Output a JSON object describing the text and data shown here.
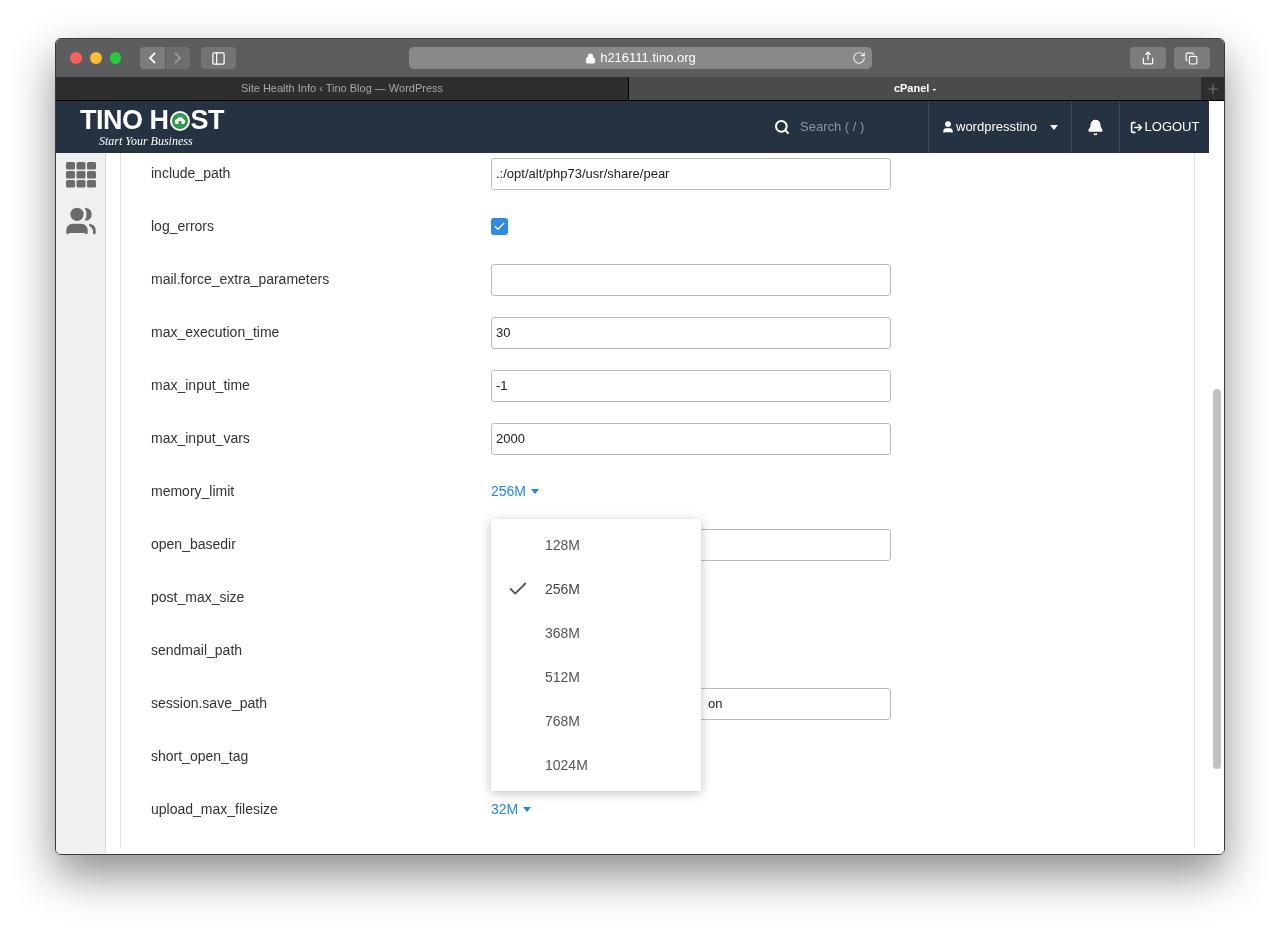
{
  "browser": {
    "url": "h216111.tino.org",
    "tabs": [
      {
        "title": "Site Health Info ‹ Tino Blog — WordPress",
        "selected": false
      },
      {
        "title": "cPanel -",
        "selected": true
      }
    ]
  },
  "header": {
    "logo": {
      "before": "TINO H",
      "after": "ST",
      "tagline": "Start Your Business"
    },
    "search_placeholder": "Search ( / )",
    "user": "wordpresstino",
    "logout": "LOGOUT"
  },
  "settings": [
    {
      "name": "include_path",
      "kind": "text",
      "value": ".:/opt/alt/php73/usr/share/pear"
    },
    {
      "name": "log_errors",
      "kind": "checkbox",
      "checked": true
    },
    {
      "name": "mail.force_extra_parameters",
      "kind": "text"
    },
    {
      "name": "max_execution_time",
      "kind": "text",
      "value": "30"
    },
    {
      "name": "max_input_time",
      "kind": "text",
      "value": "-1"
    },
    {
      "name": "max_input_vars",
      "kind": "text",
      "value": "2000"
    },
    {
      "name": "memory_limit",
      "kind": "dropdown",
      "value": "256M",
      "options": [
        {
          "label": "128M",
          "selected": false
        },
        {
          "label": "256M",
          "selected": true
        },
        {
          "label": "368M",
          "selected": false
        },
        {
          "label": "512M",
          "selected": false
        },
        {
          "label": "768M",
          "selected": false
        },
        {
          "label": "1024M",
          "selected": false
        }
      ]
    },
    {
      "name": "open_basedir",
      "kind": "text"
    },
    {
      "name": "post_max_size",
      "kind": "covered"
    },
    {
      "name": "sendmail_path",
      "kind": "covered"
    },
    {
      "name": "session.save_path",
      "kind": "covered_text",
      "value": "on"
    },
    {
      "name": "short_open_tag",
      "kind": "covered"
    },
    {
      "name": "upload_max_filesize",
      "kind": "dropdown",
      "value": "32M"
    }
  ]
}
